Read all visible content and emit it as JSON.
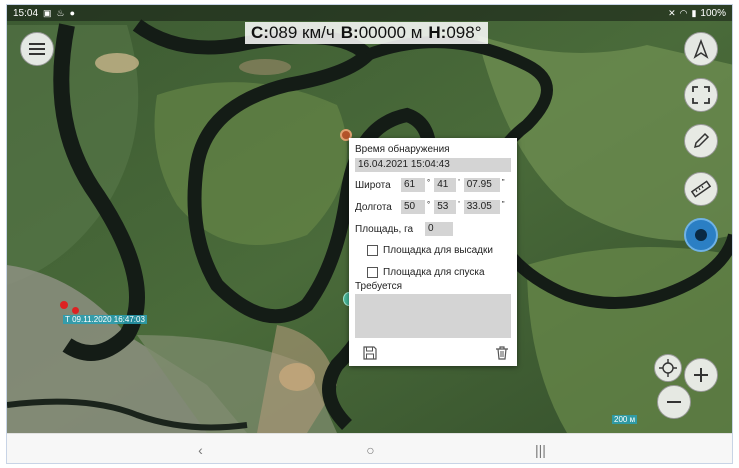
{
  "status_bar": {
    "time": "15:04",
    "battery": "100%"
  },
  "readout": {
    "speed_label": "С:",
    "speed_value": "089 км/ч",
    "height_label": "В:",
    "height_value": "00000 м",
    "heading_label": "Н:",
    "heading_value": "098°"
  },
  "map": {
    "marker_labels": [
      "Т 09.11.2020 16:47:03",
      "200 м"
    ]
  },
  "dialog": {
    "detect_label": "Время обнаружения",
    "detect_value": "16.04.2021 15:04:43",
    "lat_label": "Широта",
    "lat_deg": "61",
    "lat_min": "41",
    "lat_sec": "07.95",
    "lon_label": "Долгота",
    "lon_deg": "50",
    "lon_min": "53",
    "lon_sec": "33.05",
    "area_label": "Площадь, га",
    "area_value": "0",
    "landing_label": "Площадка для высадки",
    "descent_label": "Площадка для спуска",
    "required_label": "Требуется",
    "deg_sym": "°",
    "min_sym": "'",
    "sec_sym": "\""
  },
  "icons": {
    "menu": "menu-icon",
    "navigate": "navigation-arrow-icon",
    "fullscreen": "fullscreen-icon",
    "edit": "pencil-icon",
    "ruler": "ruler-icon",
    "record": "record-icon",
    "locate": "crosshair-icon",
    "zoom_in": "plus-icon",
    "zoom_out": "minus-icon",
    "save": "floppy-disk-icon",
    "delete": "trash-icon"
  },
  "navbar": {
    "back": "‹",
    "home": "○",
    "recents": "|||"
  },
  "colors": {
    "record_button": "#2b7fc4",
    "label_bg": "#28a0b4",
    "field_bg": "#d4d4d4"
  }
}
